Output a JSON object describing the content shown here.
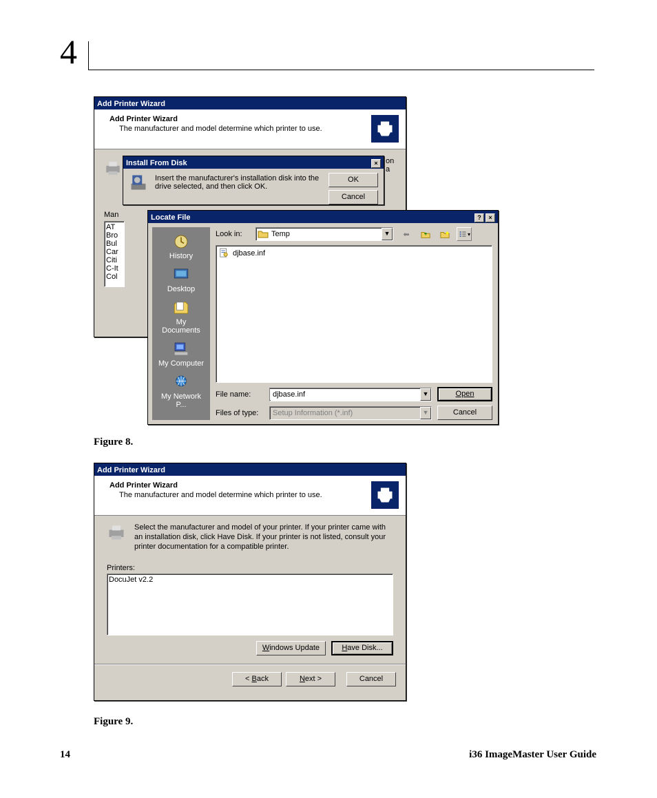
{
  "chapter": "4",
  "fig8_caption": "Figure 8.",
  "fig9_caption": "Figure 9.",
  "page_number": "14",
  "doc_title": "i36 ImageMaster User Guide",
  "wizard1": {
    "title": "Add Printer Wizard",
    "header_title": "Add Printer Wizard",
    "header_sub": "The manufacturer and model determine which printer to use.",
    "manu_label": "Man",
    "manu_items": [
      "AT",
      "Bro",
      "Bul",
      "Car",
      "Citi",
      "C-It",
      "Col"
    ]
  },
  "install_disk": {
    "title": "Install From Disk",
    "msg": "Insert the manufacturer's installation disk into the drive selected, and then click OK.",
    "ok": "OK",
    "cancel": "Cancel",
    "frag_right": "on\na"
  },
  "locate": {
    "title": "Locate File",
    "look_in_label": "Look in:",
    "look_in_value": "Temp",
    "places": [
      "History",
      "Desktop",
      "My Documents",
      "My Computer",
      "My Network P..."
    ],
    "file_item": "djbase.inf",
    "file_name_label": "File name:",
    "file_name_value": "djbase.inf",
    "files_type_label": "Files of type:",
    "files_type_value": "Setup Information (*.inf)",
    "open": "Open",
    "cancel": "Cancel"
  },
  "wizard2": {
    "title": "Add Printer Wizard",
    "header_title": "Add Printer Wizard",
    "header_sub": "The manufacturer and model determine which printer to use.",
    "body": "Select the manufacturer and model of your printer. If your printer came with an installation disk, click Have Disk. If your printer is not listed, consult your printer documentation for a compatible printer.",
    "printers_label": "Printers:",
    "printer_item": "DocuJet v2.2",
    "win_update": "Windows Update",
    "have_disk": "Have Disk...",
    "back": "< Back",
    "next": "Next >",
    "cancel": "Cancel"
  }
}
